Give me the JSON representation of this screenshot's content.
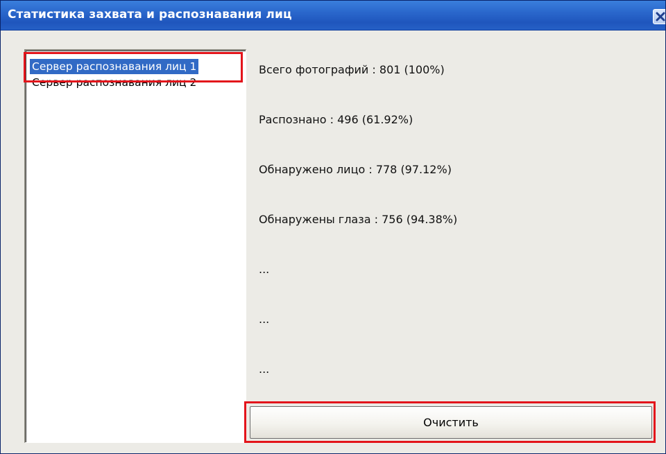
{
  "window": {
    "title": "Статистика захвата и распознавания лиц",
    "close_icon": "close-icon"
  },
  "servers": {
    "items": [
      {
        "label": "Сервер распознавания лиц 1",
        "selected": true
      },
      {
        "label": "Сервер распознавания лиц 2",
        "selected": false
      }
    ]
  },
  "stats": {
    "total": "Всего фотографий : 801 (100%)",
    "recognized": "Распознано : 496 (61.92%)",
    "face_detected": "Обнаружено лицо : 778 (97.12%)",
    "eyes_detected": "Обнаружены глаза : 756 (94.38%)",
    "ellipsis_1": "...",
    "ellipsis_2": "...",
    "ellipsis_3": "..."
  },
  "actions": {
    "clear_label": "Очистить"
  },
  "colors": {
    "title_bar": "#2a67cc",
    "selection": "#316ac5",
    "highlight": "#e3141b",
    "window_bg": "#ecebe6"
  }
}
